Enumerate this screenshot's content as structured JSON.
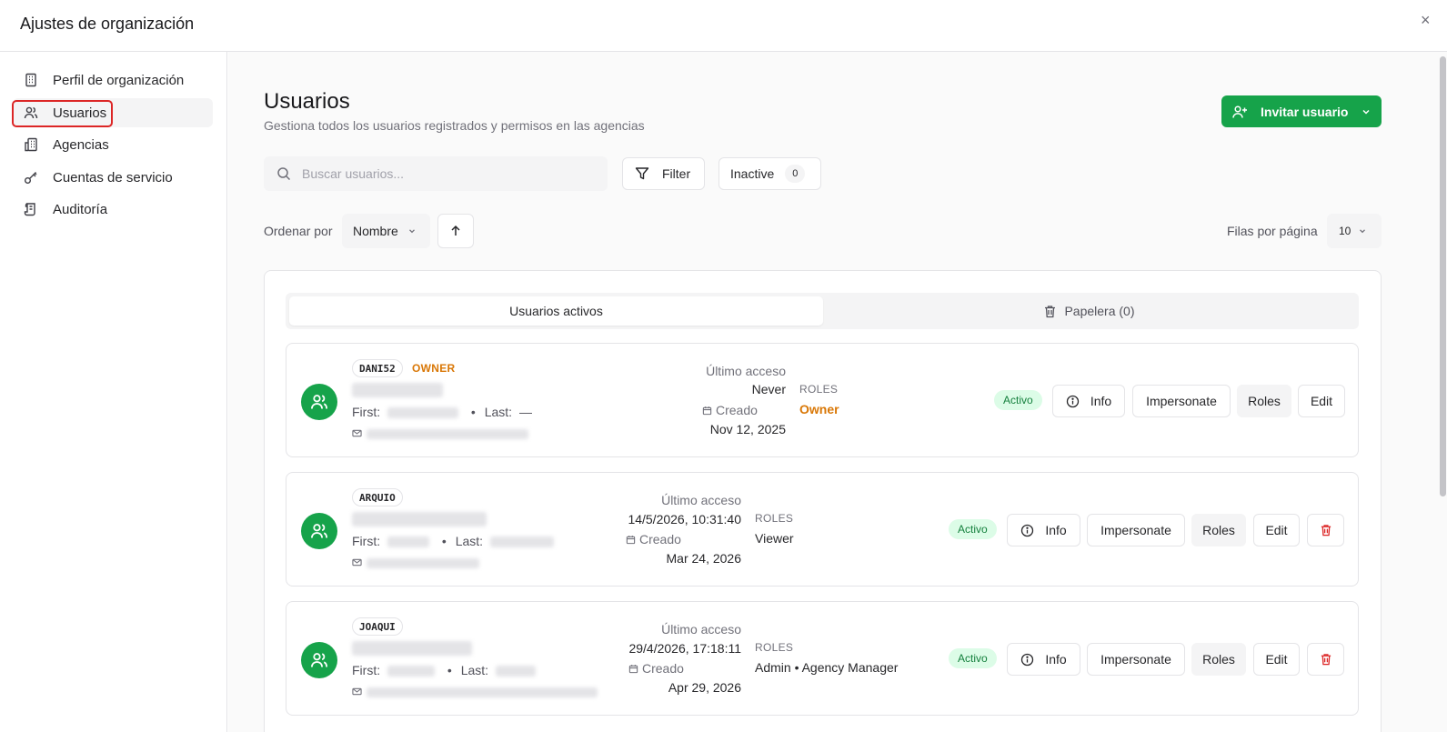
{
  "window": {
    "title": "Ajustes de organización",
    "close_icon": "×"
  },
  "sidebar": {
    "items": [
      {
        "label": "Perfil de organización",
        "icon": "building-icon"
      },
      {
        "label": "Usuarios",
        "icon": "users-icon",
        "active": true
      },
      {
        "label": "Agencias",
        "icon": "agencies-icon"
      },
      {
        "label": "Cuentas de servicio",
        "icon": "key-icon"
      },
      {
        "label": "Auditoría",
        "icon": "scroll-icon"
      }
    ]
  },
  "header": {
    "title": "Usuarios",
    "subtitle": "Gestiona todos los usuarios registrados y permisos en las agencias",
    "invite_label": "Invitar usuario"
  },
  "toolbar": {
    "search_placeholder": "Buscar usuarios...",
    "filter_label": "Filter",
    "inactive_label": "Inactive",
    "inactive_count": "0",
    "sort_label": "Ordenar por",
    "sort_value": "Nombre",
    "rows_label": "Filas por página",
    "rows_value": "10"
  },
  "tabs": {
    "active_label": "Usuarios activos",
    "trash_label": "Papelera (0)"
  },
  "labels": {
    "first": "First:",
    "last": "Last:",
    "last_access": "Último acceso",
    "created": "Creado",
    "roles": "ROLES",
    "status_active": "Activo",
    "info": "Info",
    "impersonate": "Impersonate",
    "roles_btn": "Roles",
    "edit": "Edit",
    "owner_tag": "OWNER",
    "dash": "—",
    "dot": "•"
  },
  "users": [
    {
      "username": "DANI52",
      "last_access": "Never",
      "created": "Nov 12, 2025",
      "roles": "Owner"
    },
    {
      "username": "ARQUIO",
      "last_access": "14/5/2026, 10:31:40",
      "created": "Mar 24, 2026",
      "roles": "Viewer"
    },
    {
      "username": "JOAQUI",
      "last_access": "29/4/2026, 17:18:11",
      "created": "Apr 29, 2026",
      "roles": "Admin • Agency Manager"
    }
  ],
  "colors": {
    "primary": "#16a34a",
    "owner": "#d97706",
    "danger": "#dc2626",
    "badge_bg": "#dcfce7"
  }
}
